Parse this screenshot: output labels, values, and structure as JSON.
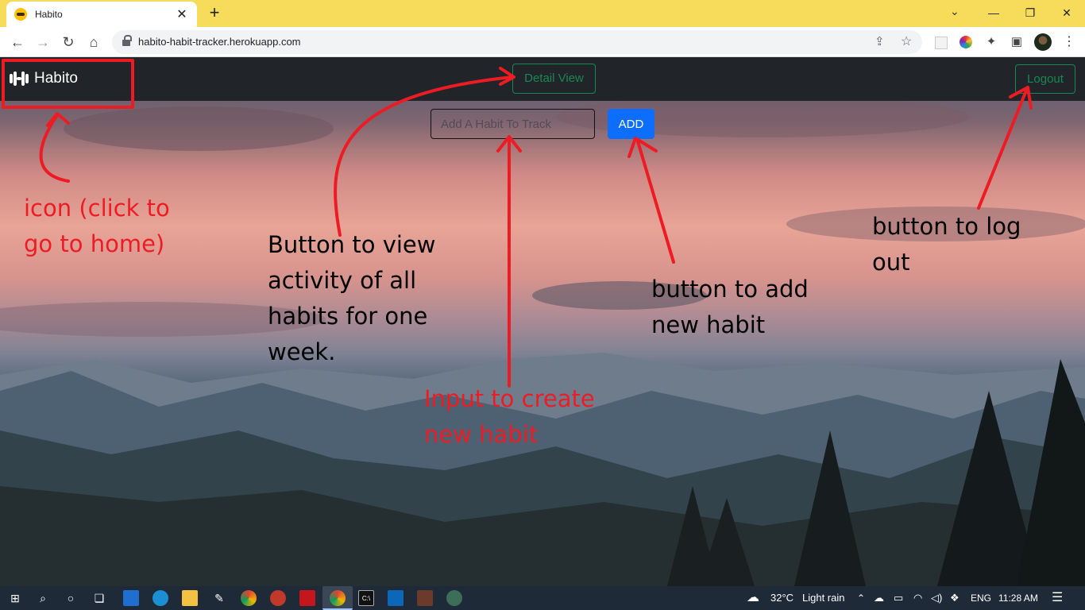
{
  "browser": {
    "tab_title": "Habito",
    "tab_close": "✕",
    "new_tab": "+",
    "url": "habito-habit-tracker.herokuapp.com",
    "window_controls": {
      "minimize": "—",
      "maximize": "❐",
      "close": "✕"
    },
    "tab_search": "⌄",
    "nav_icons": {
      "back": "←",
      "forward": "→",
      "reload": "↻",
      "home": "⌂"
    },
    "toolbar_icons": {
      "share": "⇪",
      "star": "☆",
      "extensions": "✦",
      "sidepanel": "▣",
      "menu": "⋮"
    },
    "accent_color": "#f7dc5c"
  },
  "site": {
    "brand": "Habito",
    "detail_view_label": "Detail View",
    "logout_label": "Logout",
    "habit_input_placeholder": "Add A Habit To Track",
    "add_label": "ADD",
    "navbar_color": "#212529",
    "outline_color": "#198754",
    "primary_color": "#0d6efd"
  },
  "annotations": {
    "icon_note": "icon (click to go to home)",
    "detail_note": "Button to view activity of all habits for one week.",
    "input_note": "Input to create new habit",
    "add_note": "button to add new habit",
    "logout_note": "button to log out",
    "red_color": "#ed1c24"
  },
  "taskbar": {
    "start": "⊞",
    "search": "⌕",
    "cortana": "○",
    "task_view": "❏",
    "feedback": "✎",
    "cmd": "C:\\",
    "weather_icon": "☁",
    "temperature": "32°C",
    "weather": "Light rain",
    "tray_up": "⌃",
    "tray_cloud": "☁",
    "tray_battery": "▭",
    "tray_wifi": "◠",
    "tray_volume": "◁)",
    "tray_dropbox": "❖",
    "language": "ENG",
    "time": "11:28 AM",
    "notifications": "☰"
  }
}
